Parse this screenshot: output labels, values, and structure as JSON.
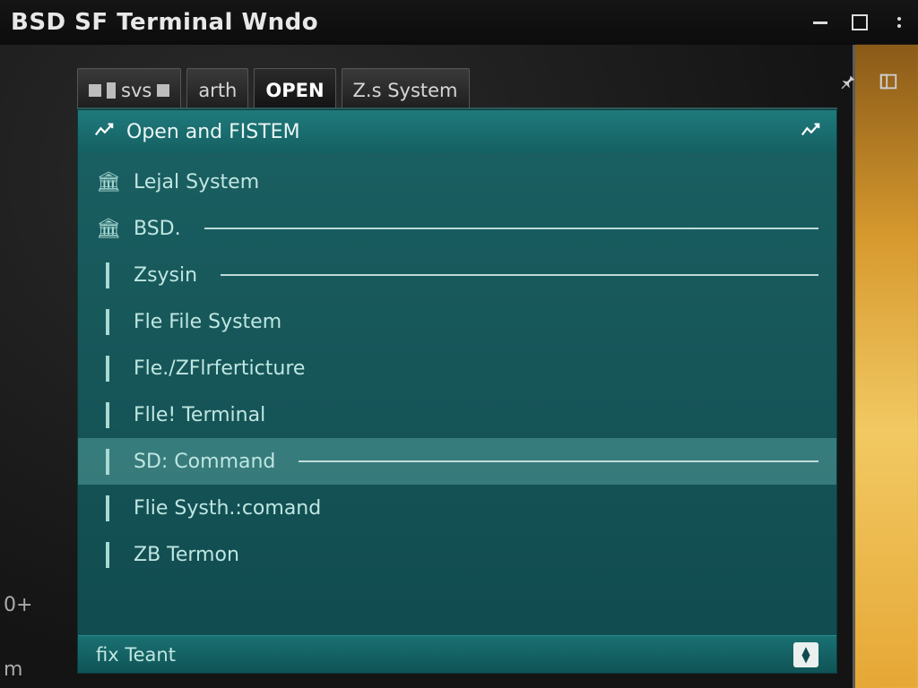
{
  "titlebar": {
    "title": "BSD SF Terminal Wndo"
  },
  "tabs": [
    {
      "label": "svs",
      "pre_square": true,
      "double_pre": true
    },
    {
      "label": "arth"
    },
    {
      "label": "OPEN",
      "active": true
    },
    {
      "label": "Z.s System"
    }
  ],
  "panel": {
    "header_label": "Open and FISTEM",
    "footer_label": "fix Teant"
  },
  "rows": [
    {
      "icon": "building",
      "label": "Lejal System",
      "rule": false,
      "highlight": false
    },
    {
      "icon": "building",
      "label": "BSD.",
      "rule": true,
      "highlight": false
    },
    {
      "icon": "doc",
      "label": "Zsysin",
      "rule": true,
      "highlight": false
    },
    {
      "icon": "doc",
      "label": "Fle File System",
      "rule": false,
      "highlight": false
    },
    {
      "icon": "doc",
      "label": "Fle./ZFlrferticture",
      "rule": false,
      "highlight": false
    },
    {
      "icon": "doc",
      "label": "Flle! Terminal",
      "rule": false,
      "highlight": false
    },
    {
      "icon": "doc",
      "label": "SD: Command",
      "rule": true,
      "highlight": true
    },
    {
      "icon": "doc",
      "label": "Flie Systh.:comand",
      "rule": false,
      "highlight": false
    },
    {
      "icon": "doc",
      "label": "ZB Termon",
      "rule": false,
      "highlight": false
    }
  ],
  "gutter": {
    "plus": "0+",
    "m": "m"
  }
}
